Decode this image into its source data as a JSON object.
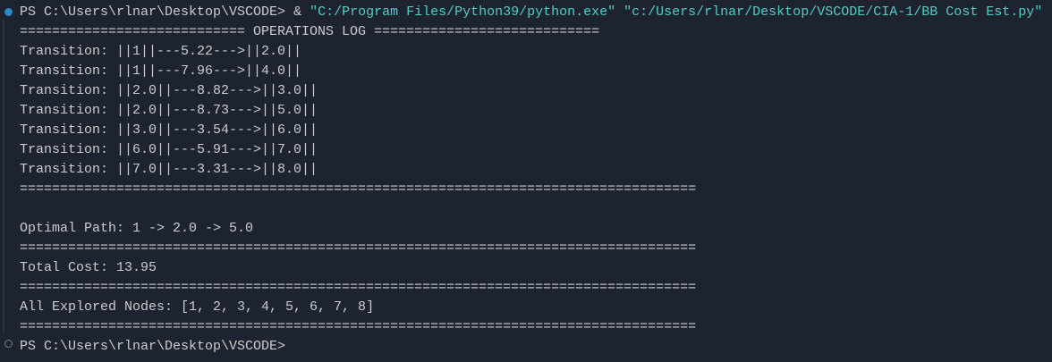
{
  "command": {
    "prompt": "PS C:\\Users\\rlnar\\Desktop\\VSCODE> ",
    "operator": "& ",
    "exe": "\"C:/Program Files/Python39/python.exe\"",
    "space": " ",
    "script": "\"c:/Users/rlnar/Desktop/VSCODE/CIA-1/BB Cost Est.py\""
  },
  "output": {
    "header": "============================ OPERATIONS LOG ============================",
    "transitions": [
      "Transition: ||1||---5.22--->||2.0||",
      "Transition: ||1||---7.96--->||4.0||",
      "Transition: ||2.0||---8.82--->||3.0||",
      "Transition: ||2.0||---8.73--->||5.0||",
      "Transition: ||3.0||---3.54--->||6.0||",
      "Transition: ||6.0||---5.91--->||7.0||",
      "Transition: ||7.0||---3.31--->||8.0||"
    ],
    "separator": "====================================================================================",
    "optimal_path": "Optimal Path: 1 -> 2.0 -> 5.0",
    "total_cost": "Total Cost: 13.95",
    "explored_nodes": "All Explored Nodes: [1, 2, 3, 4, 5, 6, 7, 8]"
  },
  "final_prompt": "PS C:\\Users\\rlnar\\Desktop\\VSCODE>",
  "colors": {
    "background": "#1e2330",
    "string": "#4fcdc5",
    "text": "#cccccc",
    "success_dot": "#2a88c2"
  }
}
